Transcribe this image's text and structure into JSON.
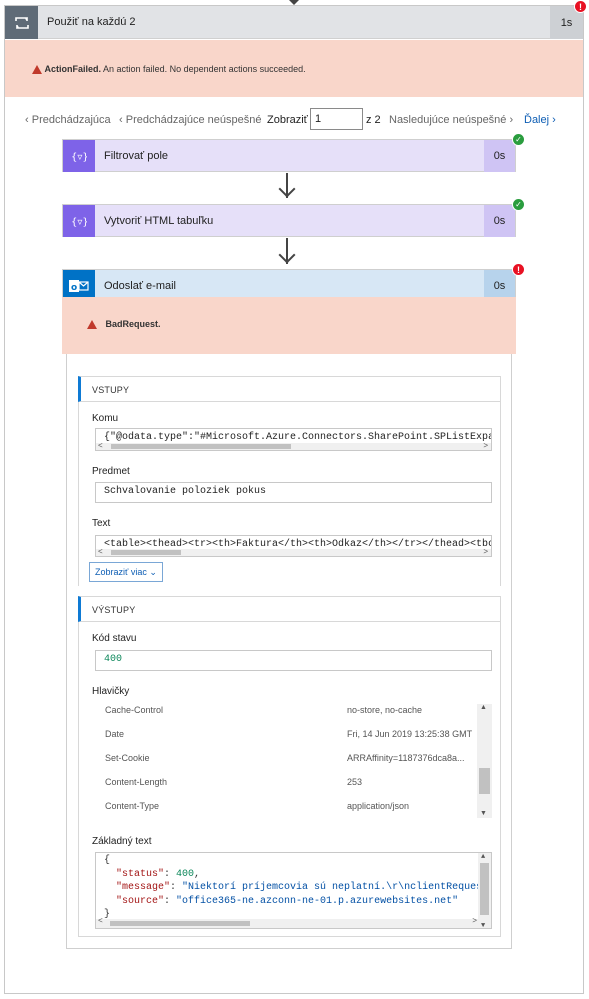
{
  "loop": {
    "title": "Použiť na každú 2",
    "duration": "1s",
    "icon": "loop-icon",
    "status": "error"
  },
  "loop_error": {
    "code": "ActionFailed.",
    "message": " An action failed. No dependent actions succeeded."
  },
  "pager": {
    "prev": "Predchádzajúca",
    "prev_failed": "Predchádzajúce neúspešné",
    "show_label": "Zobraziť",
    "page_value": "1",
    "of_label": "z 2",
    "next_failed": "Nasledujúce neúspešné",
    "next": "Ďalej"
  },
  "actions": [
    {
      "title": "Filtrovať pole",
      "duration": "0s",
      "icon": "data-operation-icon",
      "status": "success",
      "color": "#7e63e8"
    },
    {
      "title": "Vytvoriť HTML tabuľku",
      "duration": "0s",
      "icon": "data-operation-icon",
      "status": "success",
      "color": "#7e63e8"
    },
    {
      "title": "Odoslať e-mail",
      "duration": "0s",
      "icon": "outlook-icon",
      "status": "error",
      "color": "#0072c6"
    }
  ],
  "email_error": {
    "message": "BadRequest."
  },
  "inputs": {
    "label": "VSTUPY",
    "to_label": "Komu",
    "to_value": "{\"@odata.type\":\"#Microsoft.Azure.Connectors.SharePoint.SPListExpa",
    "subject_label": "Predmet",
    "subject_value": "Schvalovanie poloziek  pokus",
    "body_label": "Text",
    "body_value": "<table><thead><tr><th>Faktura</th><th>Odkaz</th></tr></thead><tbo",
    "show_more": "Zobraziť viac"
  },
  "outputs": {
    "label": "VÝSTUPY",
    "status_label": "Kód stavu",
    "status_value": "400",
    "headers_label": "Hlavičky",
    "headers": [
      {
        "key": "Cache-Control",
        "value": "no-store, no-cache"
      },
      {
        "key": "Date",
        "value": "Fri, 14 Jun 2019 13:25:38 GMT"
      },
      {
        "key": "Set-Cookie",
        "value": "ARRAffinity=1187376dca8a..."
      },
      {
        "key": "Content-Length",
        "value": "253"
      },
      {
        "key": "Content-Type",
        "value": "application/json"
      }
    ],
    "body_label": "Základný text",
    "body": {
      "open": "{",
      "status_key": "\"status\"",
      "status_val": "400",
      "message_key": "\"message\"",
      "message_val": "\"Niektorí príjemcovia sú neplatní.\\r\\nclientRequestI",
      "source_key": "\"source\"",
      "source_val": "\"office365-ne.azconn-ne-01.p.azurewebsites.net\"",
      "close": "}"
    }
  },
  "colors": {
    "error_bg": "#f9d6ca",
    "accent": "#0e7ad4",
    "data_op": "#7e63e8",
    "outlook": "#0072c6"
  }
}
